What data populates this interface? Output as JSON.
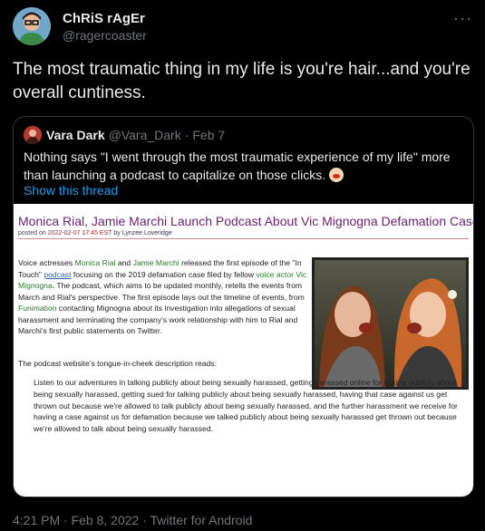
{
  "author": {
    "display_name": "ChRiS rAgEr",
    "handle": "@ragercoaster"
  },
  "more_icon": "more-horizontal-icon",
  "tweet_text": "The most traumatic thing in my life is you're hair...and you're overall cuntiness.",
  "quoted_tweet": {
    "display_name": "Vara Dark",
    "handle": "@Vara_Dark",
    "separator": "·",
    "date": "Feb 7",
    "text": "Nothing says \"I went through the most traumatic experience of my life\" more than launching a podcast to capitalize on those clicks.",
    "emoji_icon": "clown-face-icon",
    "show_thread": "Show this thread",
    "article": {
      "title": "Monica Rial, Jamie Marchi Launch Podcast About Vic Mignogna Defamation Case",
      "meta_posted_on": "posted on",
      "meta_date": "2022-02-07 17:45 EST",
      "meta_by": "by",
      "meta_author": "Lynzee Loveridge",
      "body": {
        "t1": "Voice actresses ",
        "link1": "Monica Rial",
        "t2": " and ",
        "link2": "Jamie Marchi",
        "t3": " released the first episode of the \"In Touch\" ",
        "link3": "podcast",
        "t4": " focusing on the 2019 defamation case filed by fellow ",
        "link4": "voice actor Vic Mignogna",
        "t5": ". The podcast, which aims to be updated monthly, retells the events from March and Rial's perspective. The first episode lays out the timeline of events, from ",
        "link5": "Funimation",
        "t6": " contacting Mignogna about its investigation into allegations of sexual harassment and terminating the company's work relationship with him to Rial and Marchi's first public statements on Twitter."
      },
      "p2": "The podcast website's tongue-in-cheek description reads:",
      "blockquote": "Listen to our adventures in talking publicly about being sexually harassed, getting harassed online for talking publicly about being sexually harassed, getting sued for talking publicly about being sexually harassed, having that case against us get thrown out because we're allowed to talk publicly about being sexually harassed, and the further harassment we receive for having a case against us for defamation because we talked publicly about being sexually harassed get thrown out because we're allowed to talk about being sexually harassed."
    }
  },
  "footer": {
    "time": "4:21 PM",
    "sep": " · ",
    "date": "Feb 8, 2022",
    "source": "Twitter for Android"
  }
}
